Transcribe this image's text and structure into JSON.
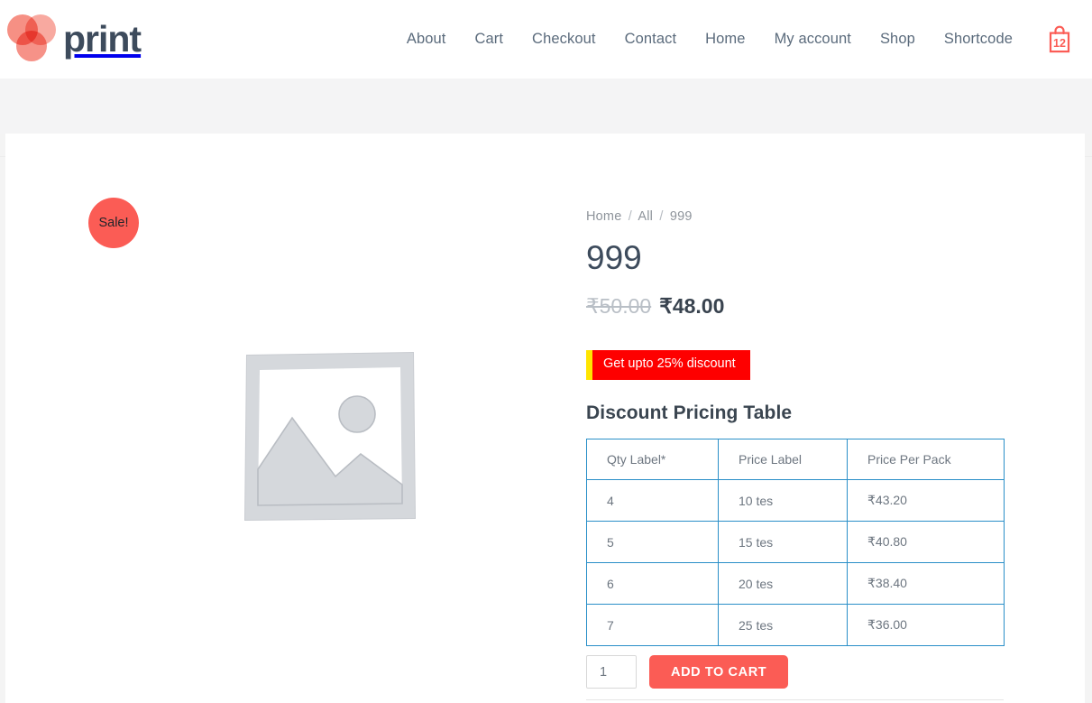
{
  "header": {
    "logo_text": "print",
    "logo_icon": "three-circles-logo-icon",
    "nav": [
      {
        "label": "About"
      },
      {
        "label": "Cart"
      },
      {
        "label": "Checkout"
      },
      {
        "label": "Contact"
      },
      {
        "label": "Home"
      },
      {
        "label": "My account"
      },
      {
        "label": "Shop"
      },
      {
        "label": "Shortcode"
      }
    ],
    "cart": {
      "icon": "shopping-bag-icon",
      "count": "12"
    }
  },
  "gallery": {
    "sale_badge": "Sale!",
    "placeholder_icon": "image-placeholder-icon"
  },
  "product": {
    "breadcrumb": {
      "home": "Home",
      "category": "All",
      "current": "999",
      "separator": "/"
    },
    "title": "999",
    "price_old": "₹50.00",
    "price_new": "₹48.00",
    "discount_badge": "Get upto 25% discount",
    "table_heading": "Discount Pricing Table",
    "pricing_table": {
      "columns": [
        "Qty Label*",
        "Price Label",
        "Price Per Pack"
      ],
      "rows": [
        [
          "4",
          "10 tes",
          "₹43.20"
        ],
        [
          "5",
          "15 tes",
          "₹40.80"
        ],
        [
          "6",
          "20 tes",
          "₹38.40"
        ],
        [
          "7",
          "25 tes",
          "₹36.00"
        ]
      ]
    },
    "quantity_value": "1",
    "quantity_placeholder": "1",
    "add_to_cart_label": "ADD TO CART"
  },
  "colors": {
    "brand_coral": "#fb5c55",
    "badge_red": "#fe0000",
    "badge_yellow": "#ffe500",
    "table_border_blue": "#2a8fc8",
    "text_dark": "#3d4b5c"
  }
}
